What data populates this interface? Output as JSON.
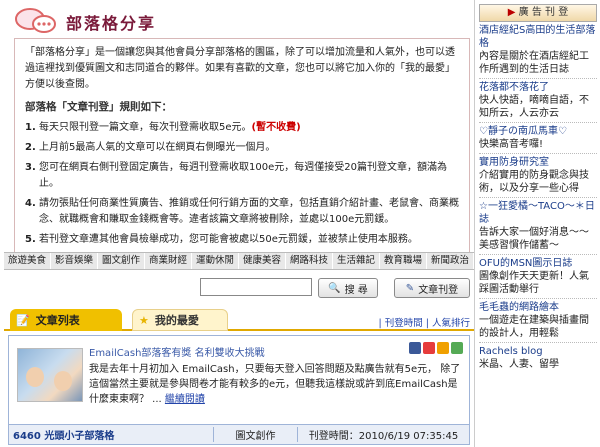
{
  "header": {
    "title": "部落格分享",
    "icon": "chat-bubbles-icon"
  },
  "intro": {
    "text": "「部落格分享」是一個讓您與其他會員分享部落格的園區，除了可以增加流量和人氣外，也可以透過這裡找到優質圖文和志同道合的夥伴。如果有喜歡的文章，您也可以將它加入你的「我的最愛」方便以後查閱。",
    "rules_title": "部落格「文章刊登」規則如下：",
    "rules": [
      {
        "num": "1.",
        "text": "每天只限刊登一篇文章，每次刊登需收取5e元。",
        "red": "(暫不收費)"
      },
      {
        "num": "2.",
        "text": "上月前5最高人氣的文章可以在網頁右側曝光一個月。",
        "red": ""
      },
      {
        "num": "3.",
        "text": "您可在網頁右側刊登固定廣告，每週刊登需收取100e元，每週僅接受20篇刊登文章，額滿為止。",
        "red": ""
      },
      {
        "num": "4.",
        "text": "請勿張貼任何商業性質廣告、推銷或任何行銷方面的文章，包括直銷介紹計畫、老鼠會、商業概念、就職概會和賺取金錢概會等。違者該篇文章將被刪除，並處以100e元罰鍰。",
        "red": ""
      },
      {
        "num": "5.",
        "text": "若刊登文章遭其他會員檢舉成功，您可能會被處以50e元罰鍰，並被禁止使用本服務。",
        "red": ""
      }
    ]
  },
  "categories": [
    "旅遊美食",
    "影音娛樂",
    "圖文創作",
    "商業財經",
    "運動休閒",
    "健康美容",
    "網路科技",
    "生活雜記",
    "教育職場",
    "新聞政治"
  ],
  "search": {
    "placeholder": "",
    "search_label": "搜 尋",
    "post_label": "文章刊登"
  },
  "tabs": {
    "list_label": "文章列表",
    "fav_label": "我的最愛"
  },
  "sort": {
    "time": "刊登時間",
    "popular": "人氣排行"
  },
  "post": {
    "title": "EmailCash部落客有獎 名利雙收大挑戰",
    "body": "我是去年十月初加入 EmailCash，只要每天登入回答問題及點廣告就有5e元， 除了這個當然主要就是參與問卷才能有較多的e元，但聽我這樣說或許到底EmailCash是什麼東東啊？ ...",
    "more": "繼續閱讀",
    "author": "6460 光頭小子部落格",
    "category": "圖文創作",
    "time_label": "刊登時間：2010/6/19 07:35:45"
  },
  "sidebar": {
    "ad_label": "廣 告 刊 登",
    "items": [
      {
        "link": "酒店經紀S高田的生活部落格",
        "desc": "內容是關於在酒店經紀工作所遇到的生活日誌"
      },
      {
        "link": "花落都不落花了",
        "desc": "快人快語，嘀嘀自語，不知所云，人云亦云"
      },
      {
        "link": "♡靜子の南瓜馬車♡",
        "desc": "快樂高音考囉!"
      },
      {
        "link": "實用防身研究室",
        "desc": "介紹實用的防身觀念與技術，以及分享一些心得"
      },
      {
        "link": "☆一狂愛橘～TACO～＊日誌",
        "desc": "告訴大家一個好消息～～美感習慣作儲蓄～"
      },
      {
        "link": "OFU的MSN圖示日誌",
        "desc": "圖像創作天天更新！人氣踩圖活動舉行"
      },
      {
        "link": "毛毛蟲的網路繪本",
        "desc": "一個遊走在建築與插畫間的設計人，用輕鬆"
      },
      {
        "link": "Rachels blog",
        "desc": "米晶、人妻、留學"
      }
    ]
  },
  "colors": {
    "title": "#7a1a3a",
    "tab_active": "#f0c000",
    "rule_red": "#cc0000",
    "link": "#1a3c8a"
  }
}
